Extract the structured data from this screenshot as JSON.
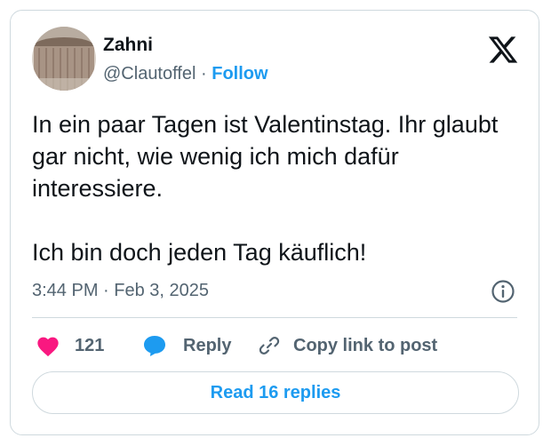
{
  "author": {
    "name": "Zahni",
    "handle": "@Clautoffel",
    "separator": "·",
    "follow_label": "Follow"
  },
  "tweet": {
    "text": "In ein paar Tagen ist Valentinstag. Ihr glaubt gar nicht, wie wenig ich mich dafür interessiere.\n\nIch bin doch jeden Tag käuflich!",
    "timestamp": "3:44 PM · Feb 3, 2025"
  },
  "actions": {
    "like_count": "121",
    "reply_label": "Reply",
    "copy_link_label": "Copy link to post"
  },
  "read_replies_label": "Read 16 replies",
  "icons": {
    "brand": "x-logo-icon",
    "info": "info-icon",
    "like": "heart-icon",
    "reply": "speech-bubble-icon",
    "copy": "link-icon"
  },
  "colors": {
    "accent": "#1d9bf0",
    "like": "#f91880",
    "text": "#0f1419",
    "muted": "#536471",
    "border": "#cfd9de"
  }
}
